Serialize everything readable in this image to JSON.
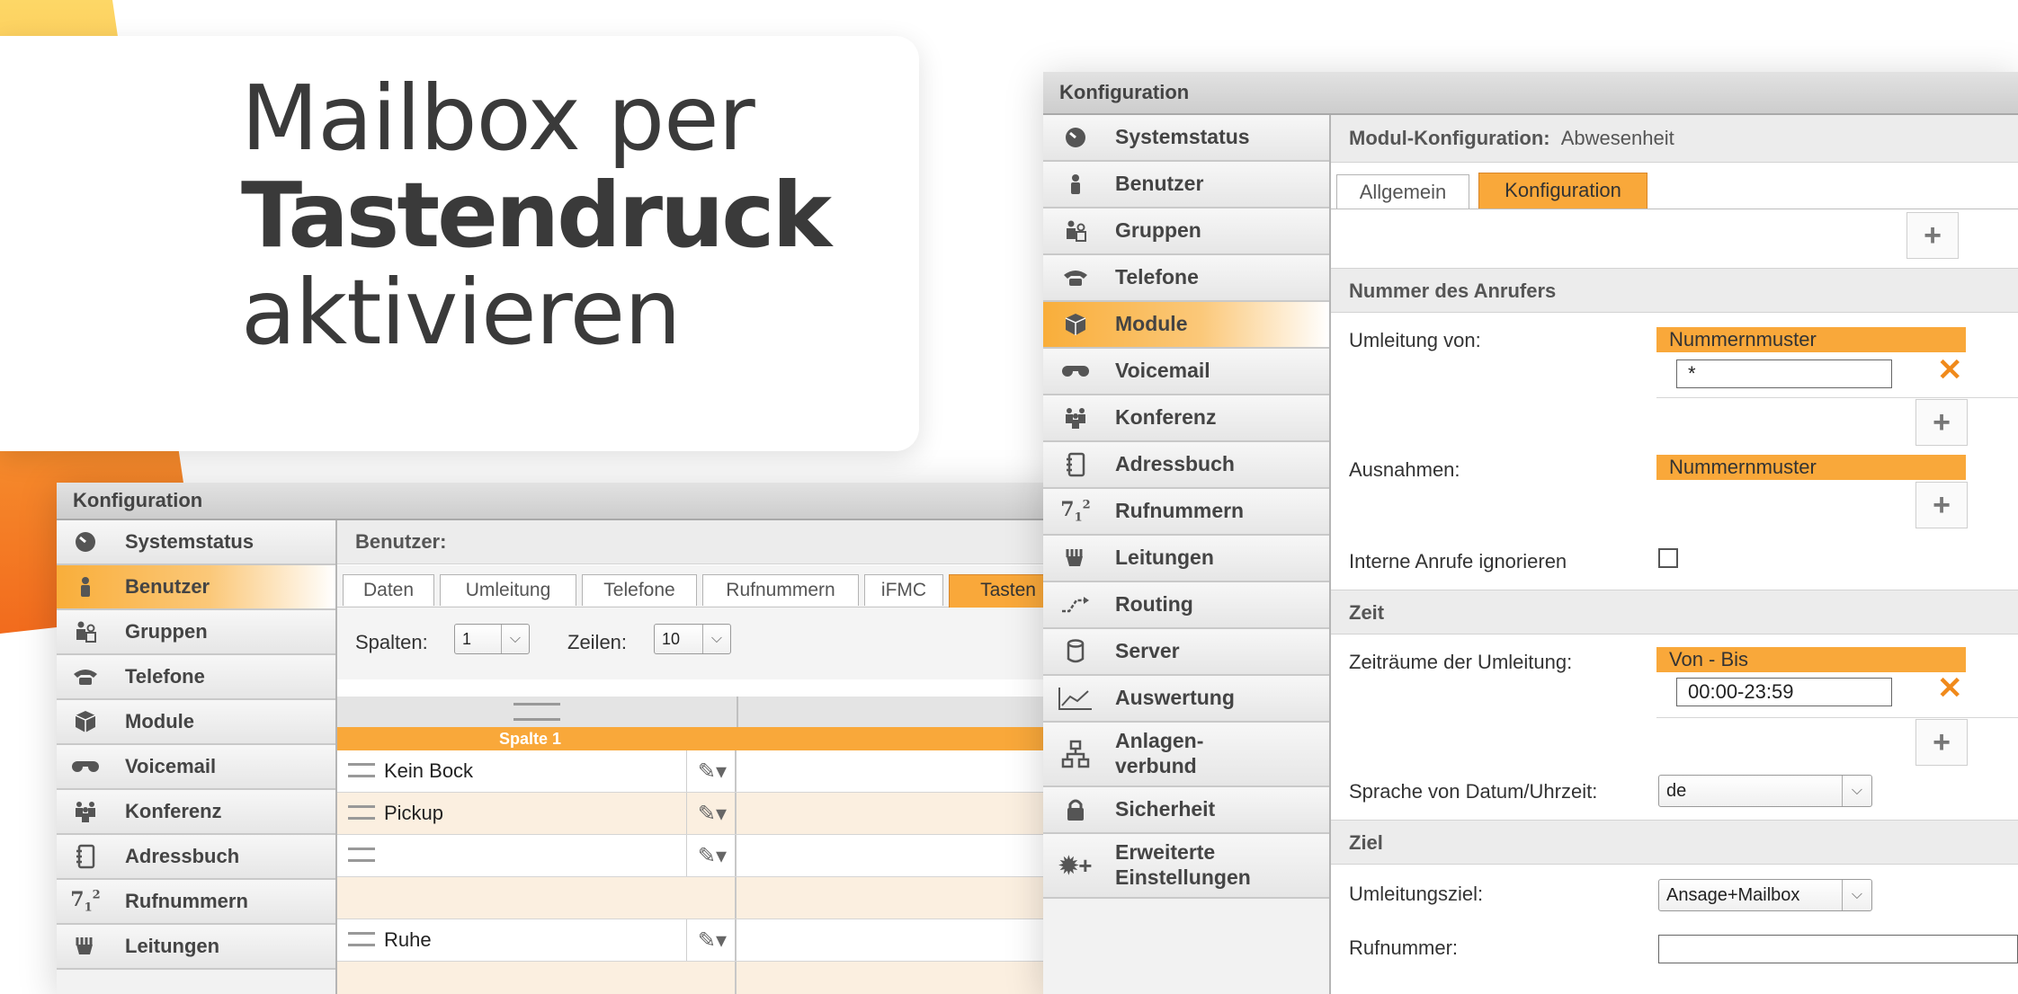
{
  "colors": {
    "accent": "#f9a83a",
    "accent_dark": "#f5821f",
    "bg_yellow": "#fdd766"
  },
  "headline": {
    "line1": "Mailbox per",
    "line2": "Tastendruck",
    "line3": "aktivieren"
  },
  "left_window": {
    "title": "Konfiguration",
    "nav": [
      {
        "icon": "gauge-icon",
        "label": "Systemstatus"
      },
      {
        "icon": "user-icon",
        "label": "Benutzer",
        "active": true
      },
      {
        "icon": "group-icon",
        "label": "Gruppen"
      },
      {
        "icon": "phone-icon",
        "label": "Telefone"
      },
      {
        "icon": "cube-icon",
        "label": "Module"
      },
      {
        "icon": "voicemail-icon",
        "label": "Voicemail"
      },
      {
        "icon": "conference-icon",
        "label": "Konferenz"
      },
      {
        "icon": "addressbook-icon",
        "label": "Adressbuch"
      },
      {
        "icon": "numbers-icon",
        "label": "Rufnummern"
      },
      {
        "icon": "lines-icon",
        "label": "Leitungen"
      }
    ],
    "header": "Benutzer:",
    "tabs": [
      "Daten",
      "Umleitung",
      "Telefone",
      "Rufnummern",
      "iFMC",
      "Tasten"
    ],
    "active_tab": "Tasten",
    "spalten_label": "Spalten:",
    "spalten_value": "1",
    "zeilen_label": "Zeilen:",
    "zeilen_value": "10",
    "column_header": "Spalte 1",
    "rows": [
      "Kein Bock",
      "Pickup",
      "",
      "",
      "Ruhe",
      ""
    ]
  },
  "right_window": {
    "title": "Konfiguration",
    "nav": [
      {
        "icon": "gauge-icon",
        "label": "Systemstatus"
      },
      {
        "icon": "user-icon",
        "label": "Benutzer"
      },
      {
        "icon": "group-icon",
        "label": "Gruppen"
      },
      {
        "icon": "phone-icon",
        "label": "Telefone"
      },
      {
        "icon": "cube-icon",
        "label": "Module",
        "active": true
      },
      {
        "icon": "voicemail-icon",
        "label": "Voicemail"
      },
      {
        "icon": "conference-icon",
        "label": "Konferenz"
      },
      {
        "icon": "addressbook-icon",
        "label": "Adressbuch"
      },
      {
        "icon": "numbers-icon",
        "label": "Rufnummern"
      },
      {
        "icon": "lines-icon",
        "label": "Leitungen"
      },
      {
        "icon": "routing-icon",
        "label": "Routing"
      },
      {
        "icon": "server-icon",
        "label": "Server"
      },
      {
        "icon": "chart-icon",
        "label": "Auswertung"
      },
      {
        "icon": "network-icon",
        "label": "Anlagen-\nverbund"
      },
      {
        "icon": "lock-icon",
        "label": "Sicherheit"
      },
      {
        "icon": "settings-plus-icon",
        "label": "Erweiterte\nEinstellungen"
      }
    ],
    "header_bold": "Modul-Konfiguration:",
    "header_value": "Abwesenheit",
    "tabs": [
      "Allgemein",
      "Konfiguration"
    ],
    "active_tab": "Konfiguration",
    "section_caller": "Nummer des Anrufers",
    "umleitung_von_label": "Umleitung von:",
    "nummernmuster": "Nummernmuster",
    "umleitung_von_value": "*",
    "ausnahmen_label": "Ausnahmen:",
    "interne_label": "Interne Anrufe ignorieren",
    "section_zeit": "Zeit",
    "zeitraeume_label": "Zeiträume der Umleitung:",
    "von_bis": "Von - Bis",
    "zeitraum_value": "00:00-23:59",
    "sprache_label": "Sprache von Datum/Uhrzeit:",
    "sprache_value": "de",
    "section_ziel": "Ziel",
    "umleitungsziel_label": "Umleitungsziel:",
    "umleitungsziel_value": "Ansage+Mailbox",
    "rufnummer_label": "Rufnummer:"
  }
}
